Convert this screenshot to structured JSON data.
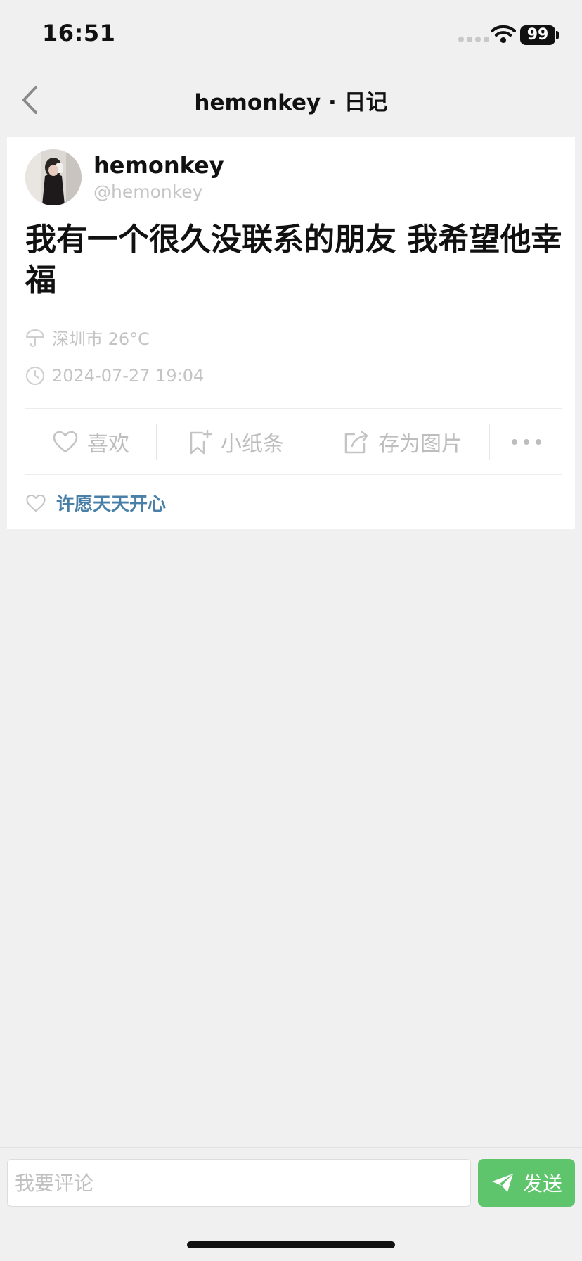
{
  "status_bar": {
    "time": "16:51",
    "battery": "99"
  },
  "nav": {
    "title": "hemonkey · 日记"
  },
  "post": {
    "user_name": "hemonkey",
    "user_handle": "@hemonkey",
    "content": "我有一个很久没联系的朋友 我希望他幸福",
    "weather": "深圳市 26°C",
    "date": "2024-07-27 19:04",
    "actions": {
      "like": "喜欢",
      "note": "小纸条",
      "save": "存为图片"
    },
    "liked_by": "许愿天天开心"
  },
  "comment": {
    "placeholder": "我要评论",
    "send": "发送"
  },
  "colors": {
    "accent_green": "#5fc56c",
    "link_blue": "#4a7fa7",
    "background": "#f1f0f1"
  },
  "icons": [
    "back-chevron-icon",
    "wifi-icon",
    "umbrella-icon",
    "clock-icon",
    "heart-icon",
    "bookmark-plus-icon",
    "share-icon",
    "more-dots-icon",
    "paper-plane-icon"
  ]
}
